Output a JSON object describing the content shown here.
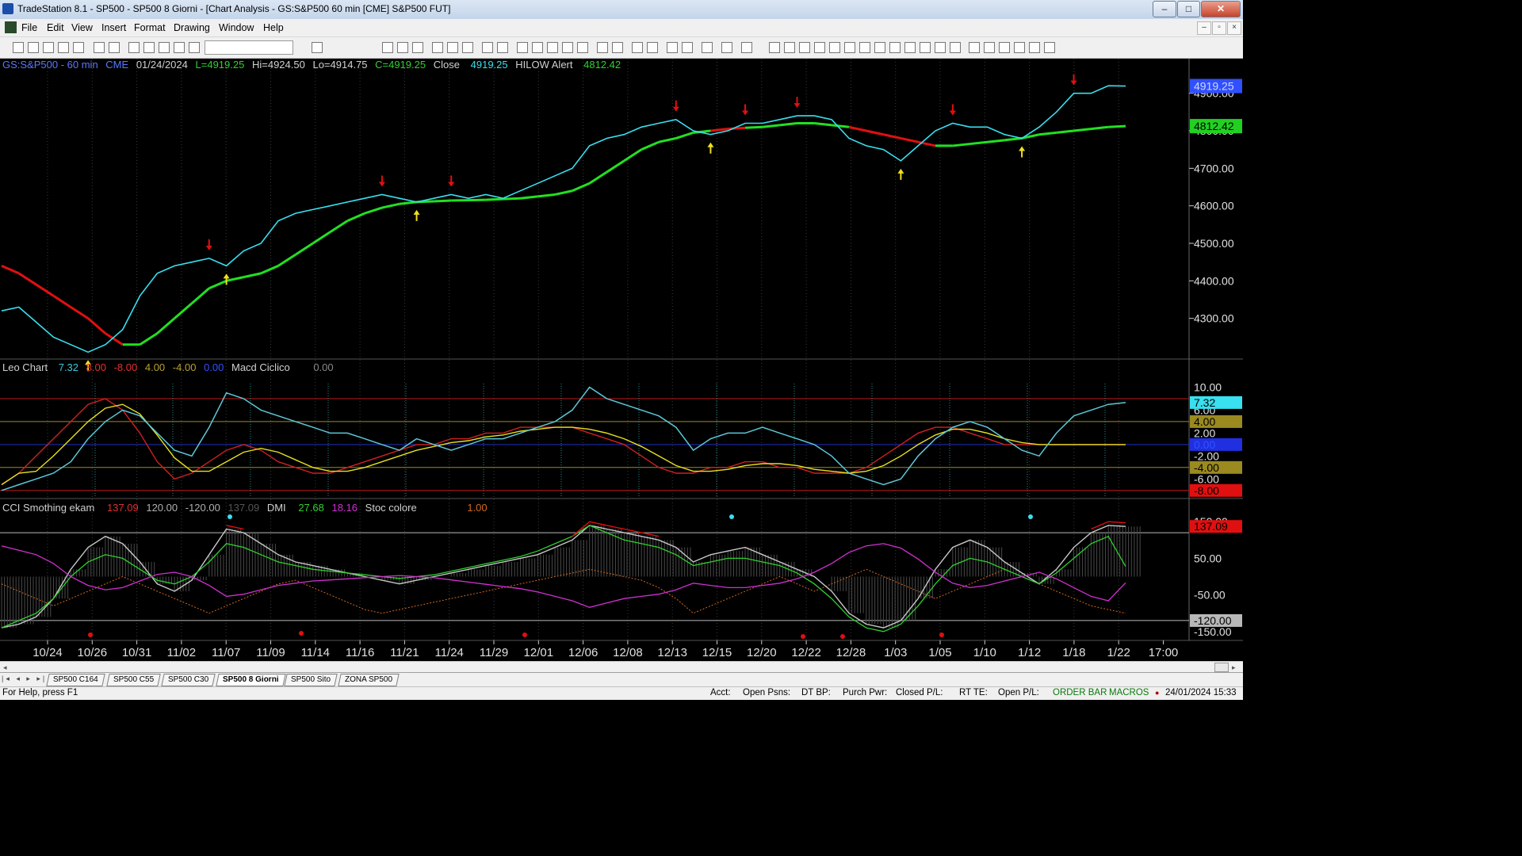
{
  "window": {
    "title": "TradeStation 8.1 - SP500 - SP500 8 Giorni - [Chart Analysis - GS:S&P500  60 min  [CME] S&P500 FUT]",
    "min_btn": "–",
    "max_btn": "□",
    "close_btn": "✕"
  },
  "menu": [
    "File",
    "Edit",
    "View",
    "Insert",
    "Format",
    "Drawing",
    "Window",
    "Help"
  ],
  "mdi_buttons": [
    "–",
    "▫",
    "×"
  ],
  "price_header": {
    "symbol": "GS:S&P500 - 60 min",
    "exchange": "CME",
    "date": "01/24/2024",
    "last": "L=4919.25",
    "hi": "Hi=4924.50",
    "lo": "Lo=4914.75",
    "close_val": "C=4919.25",
    "close_label": "Close",
    "close_num": "4919.25",
    "alert_label": "HILOW Alert",
    "alert_num": "4812.42"
  },
  "osc_header": {
    "name": "Leo Chart",
    "v1": "7.32",
    "v2": "8.00",
    "v3": "-8.00",
    "v4": "4.00",
    "v5": "-4.00",
    "v6": "0.00",
    "macd_label": "Macd Ciclico",
    "macd_val": "0.00"
  },
  "cci_header": {
    "name": "CCI Smothing ekam",
    "v1": "137.09",
    "v2": "120.00",
    "v3": "-120.00",
    "v4": "137.09",
    "dmi_label": "DMI",
    "dmi_v1": "27.68",
    "dmi_v2": "18.16",
    "stoc_label": "Stoc colore",
    "stoc_val": "1.00"
  },
  "price_axis": [
    "4900.00",
    "4800.00",
    "4700.00",
    "4600.00",
    "4500.00",
    "4400.00",
    "4300.00"
  ],
  "price_badges": {
    "last": "4919.25",
    "alert": "4812.42"
  },
  "osc_axis": [
    "10.00",
    "6.00",
    "2.00",
    "-2.00",
    "-6.00"
  ],
  "osc_badges": {
    "val": "7.32",
    "hi": "4.00",
    "zero": "0.00",
    "lo": "-4.00",
    "min": "-8.00"
  },
  "cci_axis": [
    "150.00",
    "50.00",
    "-50.00",
    "-150.00"
  ],
  "cci_badges": {
    "val": "137.09",
    "lo": "-120.00"
  },
  "time_axis": [
    "10/24",
    "10/26",
    "10/31",
    "11/02",
    "11/07",
    "11/09",
    "11/14",
    "11/16",
    "11/21",
    "11/24",
    "11/29",
    "12/01",
    "12/06",
    "12/08",
    "12/13",
    "12/15",
    "12/20",
    "12/22",
    "12/28",
    "1/03",
    "1/05",
    "1/10",
    "1/12",
    "1/18",
    "1/22",
    "17:00"
  ],
  "tabs": [
    "SP500 C164",
    "SP500 C55",
    "SP500 C30",
    "SP500 8 Giorni",
    "SP500 Sito",
    "ZONA SP500"
  ],
  "active_tab": "SP500 8 Giorni",
  "status": {
    "help": "For Help, press F1",
    "acct": "Acct:",
    "open_psns": "Open Psns:",
    "dt_bp": "DT BP:",
    "purch_pwr": "Purch Pwr:",
    "closed_pl": "Closed P/L:",
    "rt_te": "RT TE:",
    "open_pl": "Open P/L:",
    "order_bar": "ORDER BAR",
    "macros": "MACROS",
    "datetime": "24/01/2024 15:33"
  },
  "colors": {
    "price_line": "#38e0f0",
    "avg_up": "#22e022",
    "avg_down": "#e01010",
    "osc_main": "#5ec7d8",
    "osc_red": "#d02020",
    "osc_yellow": "#e8e020",
    "cci_gray": "#c8c8c8",
    "cci_red": "#e01010",
    "dmi_green": "#30d030",
    "dmi_magenta": "#d030d0",
    "stoc_orange": "#d2691e"
  },
  "chart_data": [
    {
      "type": "line",
      "ylim": [
        4200,
        4950
      ],
      "series": [
        {
          "name": "Close",
          "values": [
            4320,
            4330,
            4290,
            4250,
            4230,
            4210,
            4230,
            4270,
            4360,
            4420,
            4440,
            4450,
            4460,
            4440,
            4480,
            4500,
            4560,
            4580,
            4590,
            4600,
            4610,
            4620,
            4630,
            4620,
            4610,
            4620,
            4630,
            4620,
            4630,
            4620,
            4640,
            4660,
            4680,
            4700,
            4760,
            4780,
            4790,
            4810,
            4820,
            4830,
            4800,
            4790,
            4800,
            4820,
            4820,
            4830,
            4840,
            4840,
            4830,
            4780,
            4760,
            4750,
            4720,
            4760,
            4800,
            4820,
            4810,
            4810,
            4790,
            4780,
            4810,
            4850,
            4900,
            4900,
            4920,
            4919.25
          ]
        },
        {
          "name": "HILOW Alert",
          "values": [
            4440,
            4420,
            4390,
            4360,
            4330,
            4300,
            4260,
            4230,
            4230,
            4260,
            4300,
            4340,
            4380,
            4400,
            4410,
            4420,
            4440,
            4470,
            4500,
            4530,
            4560,
            4580,
            4595,
            4605,
            4610,
            4612,
            4614,
            4615,
            4616,
            4618,
            4620,
            4625,
            4630,
            4640,
            4660,
            4690,
            4720,
            4750,
            4770,
            4780,
            4795,
            4800,
            4805,
            4808,
            4810,
            4815,
            4820,
            4820,
            4815,
            4810,
            4800,
            4790,
            4780,
            4770,
            4760,
            4760,
            4765,
            4770,
            4775,
            4780,
            4790,
            4795,
            4800,
            4805,
            4810,
            4812.42
          ]
        }
      ]
    },
    {
      "type": "line",
      "ylim": [
        -9,
        12
      ],
      "series": [
        {
          "name": "Leo Chart",
          "values": [
            -8,
            -7,
            -6,
            -5,
            -3,
            1,
            4,
            6,
            5,
            2,
            -1,
            -2,
            3,
            9,
            8,
            6,
            5,
            4,
            3,
            2,
            2,
            1,
            0,
            -1,
            1,
            0,
            -1,
            0,
            1,
            1,
            2,
            3,
            4,
            6,
            10,
            8,
            7,
            6,
            5,
            3,
            -1,
            1,
            2,
            2,
            3,
            2,
            1,
            0,
            -2,
            -5,
            -6,
            -7,
            -6,
            -2,
            1,
            3,
            4,
            3,
            1,
            -1,
            -2,
            2,
            5,
            6,
            7,
            7.32
          ]
        },
        {
          "name": "Macd Ciclico",
          "values": [
            -7,
            -5,
            -2,
            1,
            4,
            7,
            8,
            6,
            2,
            -3,
            -6,
            -5,
            -3,
            -1,
            0,
            -1,
            -3,
            -4,
            -5,
            -5,
            -4,
            -3,
            -2,
            -1,
            0,
            0,
            1,
            1,
            2,
            2,
            3,
            3,
            3,
            3,
            2,
            1,
            0,
            -2,
            -4,
            -5,
            -5,
            -4,
            -4,
            -3,
            -3,
            -4,
            -4,
            -5,
            -5,
            -5,
            -4,
            -2,
            0,
            2,
            3,
            3,
            2,
            1,
            0,
            0,
            0,
            0,
            0,
            0,
            0,
            0
          ]
        }
      ]
    },
    {
      "type": "line",
      "ylim": [
        -170,
        170
      ],
      "series": [
        {
          "name": "CCI Smothing ekam",
          "values": [
            -140,
            -130,
            -110,
            -60,
            20,
            80,
            110,
            90,
            40,
            -20,
            -40,
            -10,
            60,
            130,
            120,
            90,
            60,
            40,
            30,
            20,
            10,
            0,
            -10,
            -20,
            -10,
            0,
            10,
            20,
            30,
            40,
            50,
            60,
            80,
            100,
            140,
            130,
            120,
            110,
            100,
            80,
            40,
            60,
            70,
            80,
            60,
            40,
            20,
            0,
            -40,
            -100,
            -130,
            -140,
            -120,
            -60,
            20,
            80,
            100,
            80,
            40,
            10,
            -20,
            20,
            80,
            120,
            140,
            137.09
          ]
        },
        {
          "name": "DMI",
          "values": [
            -140,
            -120,
            -100,
            -60,
            0,
            40,
            60,
            50,
            20,
            -10,
            -20,
            0,
            40,
            90,
            80,
            60,
            40,
            30,
            20,
            15,
            10,
            5,
            0,
            -5,
            0,
            5,
            15,
            25,
            35,
            45,
            55,
            70,
            90,
            110,
            140,
            120,
            100,
            90,
            80,
            60,
            30,
            40,
            50,
            50,
            40,
            30,
            10,
            -20,
            -60,
            -110,
            -140,
            -150,
            -130,
            -80,
            -20,
            30,
            50,
            40,
            20,
            0,
            -20,
            10,
            50,
            90,
            110,
            27.68
          ]
        },
        {
          "name": "Stoc colore",
          "values": [
            -20,
            -40,
            -60,
            -80,
            -60,
            -40,
            -20,
            0,
            -20,
            -40,
            -60,
            -80,
            -100,
            -80,
            -60,
            -40,
            -20,
            -10,
            -30,
            -50,
            -70,
            -90,
            -100,
            -90,
            -80,
            -70,
            -60,
            -50,
            -40,
            -30,
            -20,
            -10,
            0,
            10,
            20,
            10,
            0,
            -10,
            -30,
            -60,
            -100,
            -80,
            -60,
            -40,
            -20,
            0,
            -20,
            -40,
            -20,
            0,
            20,
            0,
            -20,
            -40,
            -60,
            -40,
            -20,
            0,
            20,
            0,
            -20,
            -40,
            -60,
            -80,
            -90,
            -100
          ]
        }
      ]
    }
  ]
}
